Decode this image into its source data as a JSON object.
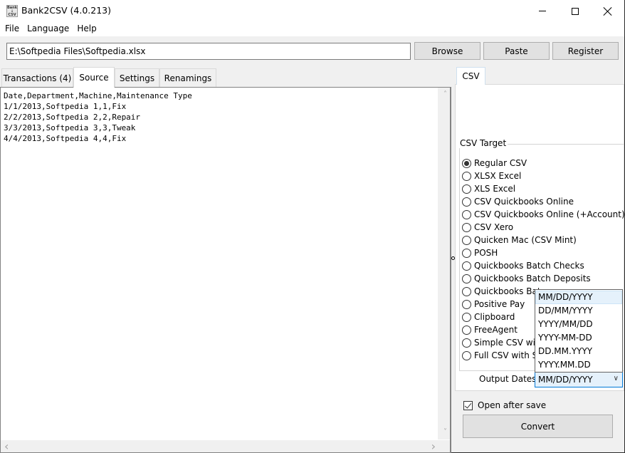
{
  "window": {
    "title": "Bank2CSV (4.0.213)",
    "icon_text": "Bank\n↓\nCSV",
    "controls": [
      "minimize-icon",
      "maximize-icon",
      "close-icon"
    ]
  },
  "menu": {
    "items": [
      {
        "label": "File"
      },
      {
        "label": "Language"
      },
      {
        "label": "Help"
      }
    ]
  },
  "toolbar": {
    "path_value": "E:\\Softpedia Files\\Softpedia.xlsx",
    "browse_label": "Browse",
    "paste_label": "Paste",
    "register_label": "Register"
  },
  "left_tabs": {
    "items": [
      {
        "label": "Transactions (4)",
        "active": false
      },
      {
        "label": "Source",
        "active": true
      },
      {
        "label": "Settings",
        "active": false
      },
      {
        "label": "Renamings",
        "active": false
      }
    ]
  },
  "source": {
    "lines": [
      "Date,Department,Machine,Maintenance Type",
      "1/1/2013,Softpedia 1,1,Fix",
      "2/2/2013,Softpedia 2,2,Repair",
      "3/3/2013,Softpedia 3,3,Tweak",
      "4/4/2013,Softpedia 4,4,Fix"
    ]
  },
  "scroll_glyphs": {
    "up": "˄",
    "down": "˅",
    "left": "‹",
    "right": "›"
  },
  "right_tabs": {
    "items": [
      {
        "label": "CSV",
        "active": true
      }
    ]
  },
  "csv_target": {
    "label": "CSV Target",
    "selected": "Regular CSV",
    "options": [
      {
        "label": "Regular CSV",
        "checked": true
      },
      {
        "label": "XLSX Excel",
        "checked": false
      },
      {
        "label": "XLS Excel",
        "checked": false
      },
      {
        "label": "CSV Quickbooks Online",
        "checked": false
      },
      {
        "label": "CSV Quickbooks Online (+Account)",
        "checked": false
      },
      {
        "label": "CSV Xero",
        "checked": false
      },
      {
        "label": "Quicken Mac (CSV Mint)",
        "checked": false
      },
      {
        "label": "POSH",
        "checked": false
      },
      {
        "label": "Quickbooks Batch Checks",
        "checked": false
      },
      {
        "label": "Quickbooks Batch Deposits",
        "checked": false
      },
      {
        "label": "Quickbooks Batc",
        "checked": false
      },
      {
        "label": "Positive Pay",
        "checked": false
      },
      {
        "label": "Clipboard",
        "checked": false
      },
      {
        "label": "FreeAgent",
        "checked": false
      },
      {
        "label": "Simple CSV with",
        "checked": false
      },
      {
        "label": "Full CSV with Sp",
        "checked": false
      }
    ]
  },
  "output_dates": {
    "label": "Output Dates:",
    "value": "MM/DD/YYYY",
    "chevron": "∨",
    "options": [
      "MM/DD/YYYY",
      "DD/MM/YYYY",
      "YYYY/MM/DD",
      "YYYY-MM-DD",
      "DD.MM.YYYY",
      "YYYY.MM.DD"
    ],
    "highlighted": "MM/DD/YYYY"
  },
  "open_after_save": {
    "label": "Open after save",
    "checked": true
  },
  "convert_label": "Convert",
  "colors": {
    "accent": "#0078d7",
    "highlight": "#e5f1fb",
    "button_face": "#e1e1e1",
    "window_bg": "#f0f0f0"
  }
}
